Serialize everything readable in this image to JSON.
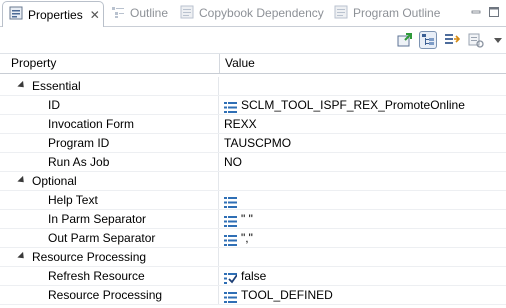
{
  "tabs": [
    {
      "label": "Properties",
      "icon": "properties-icon",
      "active": true
    },
    {
      "label": "Outline",
      "icon": "outline-icon",
      "active": false
    },
    {
      "label": "Copybook Dependency",
      "icon": "copybook-icon",
      "active": false
    },
    {
      "label": "Program Outline",
      "icon": "program-outline-icon",
      "active": false
    }
  ],
  "toolbar": {
    "buttons": [
      "pin-view-icon",
      "show-categories-icon",
      "show-advanced-icon",
      "restore-defaults-icon",
      "view-menu-icon"
    ]
  },
  "table": {
    "col_property": "Property",
    "col_value": "Value",
    "rows": [
      {
        "type": "category",
        "label": "Essential",
        "value": ""
      },
      {
        "type": "prop",
        "label": "ID",
        "value": "SCLM_TOOL_ISPF_REX_PromoteOnline",
        "icon": "list-icon"
      },
      {
        "type": "prop",
        "label": "Invocation Form",
        "value": "REXX"
      },
      {
        "type": "prop",
        "label": "Program ID",
        "value": "TAUSCPMO"
      },
      {
        "type": "prop",
        "label": "Run As Job",
        "value": "NO"
      },
      {
        "type": "category",
        "label": "Optional",
        "value": ""
      },
      {
        "type": "prop",
        "label": "Help Text",
        "value": "",
        "icon": "list-icon"
      },
      {
        "type": "prop",
        "label": "In Parm Separator",
        "value": "\" \"",
        "icon": "list-icon"
      },
      {
        "type": "prop",
        "label": "Out Parm Separator",
        "value": "\",\"",
        "icon": "list-icon"
      },
      {
        "type": "category",
        "label": "Resource Processing",
        "value": ""
      },
      {
        "type": "prop",
        "label": "Refresh Resource",
        "value": "false",
        "icon": "checkbox-list-icon"
      },
      {
        "type": "prop",
        "label": "Resource Processing",
        "value": "TOOL_DEFINED",
        "icon": "list-icon"
      }
    ]
  },
  "colors": {
    "accent": "#2f6fb5",
    "grid": "#e4e7eb"
  }
}
